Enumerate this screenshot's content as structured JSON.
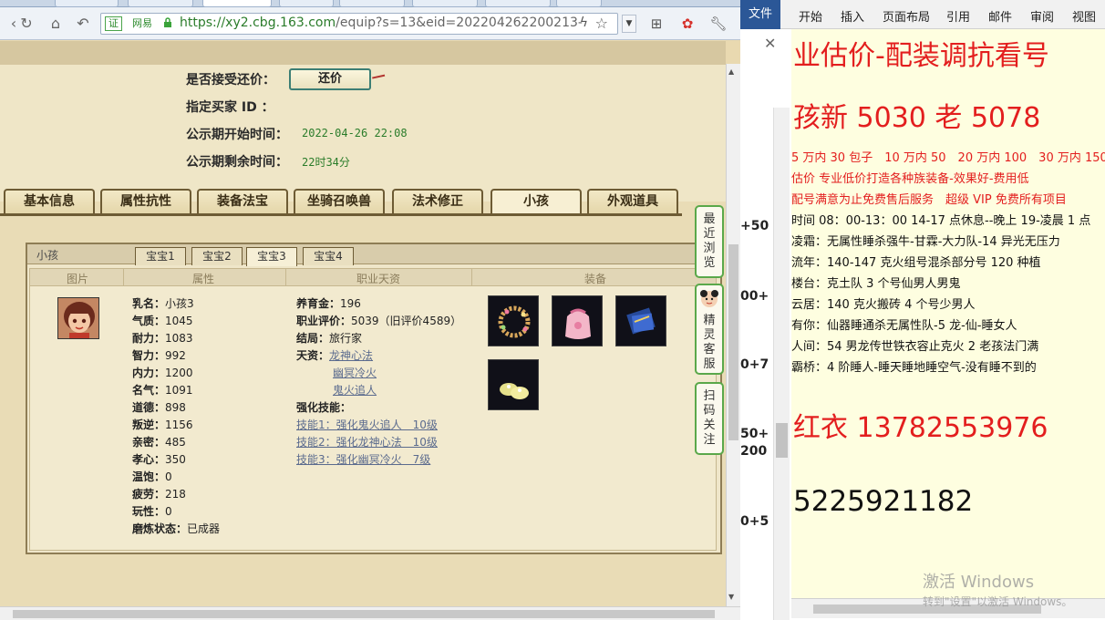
{
  "browser": {
    "address": {
      "cert_label": "证",
      "site_label": "网易",
      "url_domain": "https://xy2.cbg.163.com",
      "url_path": "/equip?s=13&eid=202204262200213-"
    }
  },
  "info": {
    "accept_counter_label": "是否接受还价：",
    "counter_button": "还价",
    "buyer_id_label": "指定买家 ID  ：",
    "public_start_label": "公示期开始时间：",
    "public_start_value": "2022-04-26 22:08",
    "public_left_label": "公示期剩余时间：",
    "public_left_value": "22时34分"
  },
  "main_tabs": [
    "基本信息",
    "属性抗性",
    "装备法宝",
    "坐骑召唤兽",
    "法术修正",
    "小孩",
    "外观道具"
  ],
  "panel": {
    "title": "小孩",
    "pet_tabs": [
      "宝宝1",
      "宝宝2",
      "宝宝3",
      "宝宝4"
    ],
    "columns": [
      "图片",
      "属性",
      "职业天资",
      "装备"
    ],
    "attributes": [
      {
        "label": "乳名：",
        "value": "小孩3"
      },
      {
        "label": "气质：",
        "value": "1045"
      },
      {
        "label": "耐力：",
        "value": "1083"
      },
      {
        "label": "智力：",
        "value": "992"
      },
      {
        "label": "内力：",
        "value": "1200"
      },
      {
        "label": "名气：",
        "value": "1091"
      },
      {
        "label": "道德：",
        "value": "898"
      },
      {
        "label": "叛逆：",
        "value": "1156"
      },
      {
        "label": "亲密：",
        "value": "485"
      },
      {
        "label": "孝心：",
        "value": "350"
      },
      {
        "label": "温饱：",
        "value": "0"
      },
      {
        "label": "疲劳：",
        "value": "218"
      },
      {
        "label": "玩性：",
        "value": "0"
      },
      {
        "label": "磨炼状态：",
        "value": "已成器"
      }
    ],
    "career": {
      "raise_label": "养育金：",
      "raise_value": "196",
      "rating_label": "职业评价：",
      "rating_value": "5039（旧评价4589）",
      "ending_label": "结局：",
      "ending_value": "旅行家",
      "talent_label": "天资：",
      "talents": [
        "龙神心法",
        "幽冥冷火",
        "鬼火追人"
      ],
      "skills_label": "强化技能：",
      "skills": [
        "技能1：强化鬼火追人　10级",
        "技能2：强化龙神心法　10级",
        "技能3：强化幽冥冷火　7级"
      ]
    }
  },
  "dock": {
    "recent": "最近浏览",
    "service": "精灵客服",
    "scan": "扫码关注"
  },
  "word": {
    "ribbon_tabs": [
      "文件",
      "开始",
      "插入",
      "页面布局",
      "引用",
      "邮件",
      "审阅",
      "视图"
    ],
    "left_numbers": [
      "+50",
      "00+",
      "0+7",
      "50+",
      "200",
      "0+5"
    ],
    "lines": {
      "title": "业估价-配装调抗看号",
      "kids": "孩新 5030 老 5078",
      "prices": "5 万内 30 包子　10 万内 50　20 万内 100　30 万内 150",
      "l4": "估价  专业低价打造各种族装备-效果好-费用低",
      "l5": "配号满意为止免费售后服务　超级 VIP 免费所有项目",
      "l6": "时间 08：00-13：00  14-17 点休息--晚上 19-凌晨 1 点",
      "l7": "凌霜：无属性睡杀强牛-甘霖-大力队-14 异光无压力",
      "l8": "流年：140-147 克火组号混杀部分号 120 种植",
      "l9": "楼台：克土队 3 个号仙男人男鬼",
      "l10": "云居：140 克火搬砖 4 个号少男人",
      "l11": "有你：仙器睡通杀无属性队-5 龙-仙-睡女人",
      "l12": "人间：54 男龙传世铁衣容止克火 2 老孩法门满",
      "l13": "霸桥：4 阶睡人-睡天睡地睡空气-没有睡不到的",
      "phone": "红衣 13782553976",
      "number2": "5225921182"
    },
    "watermark_line1": "激活 Windows",
    "watermark_line2": "转到\"设置\"以激活 Windows。"
  }
}
